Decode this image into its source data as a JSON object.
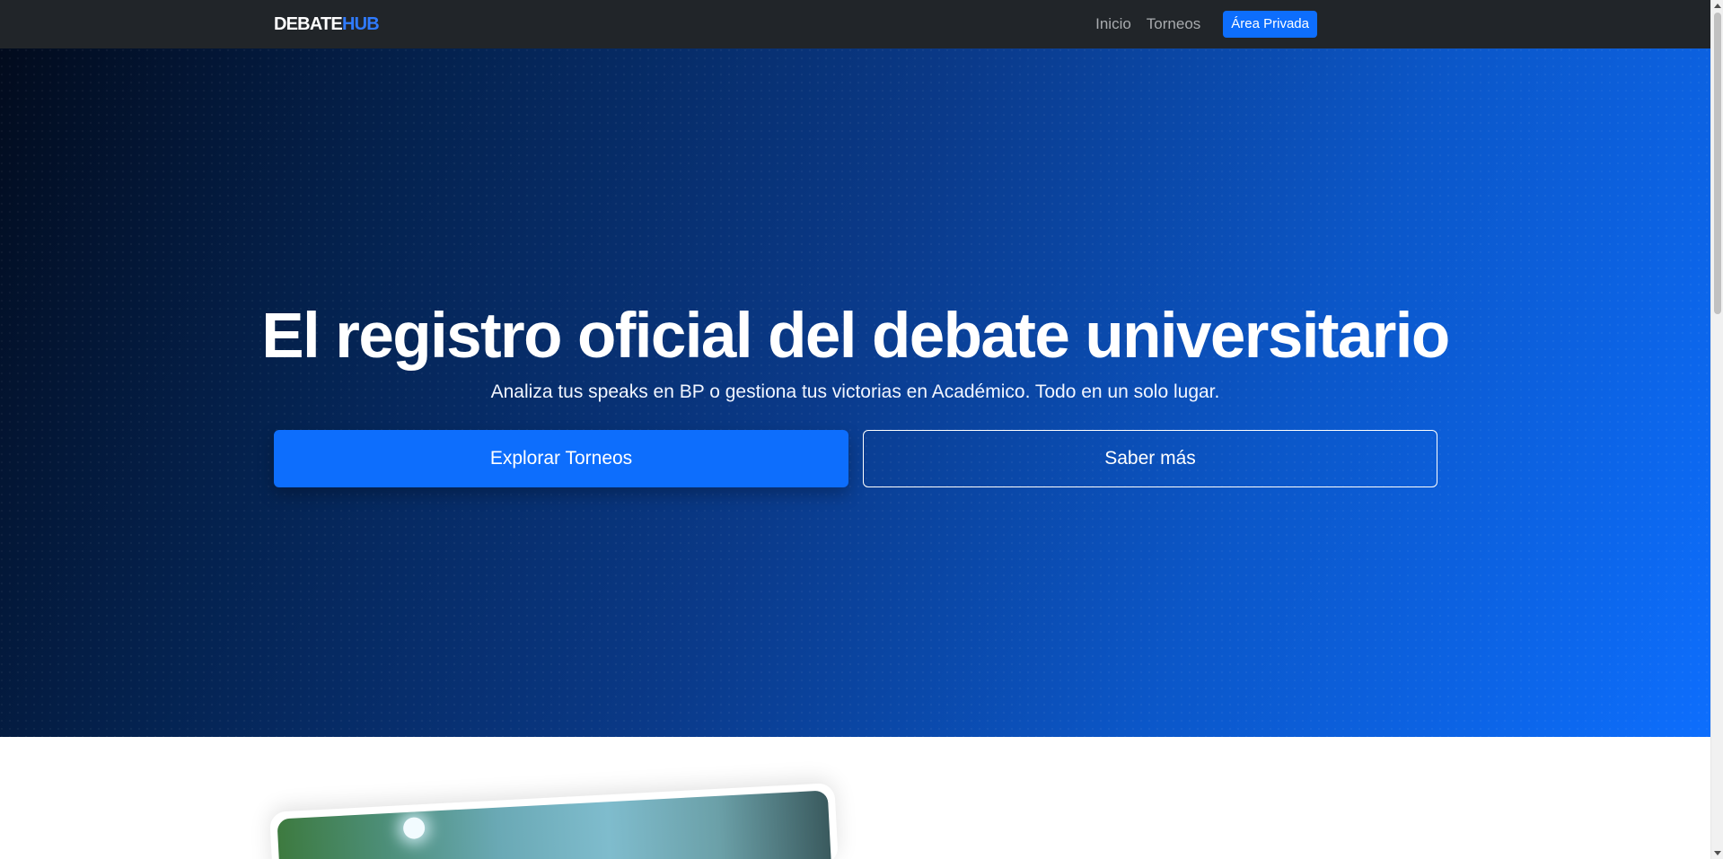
{
  "navbar": {
    "brand_part1": "DEBATE",
    "brand_part2": "HUB",
    "links": [
      "Inicio",
      "Torneos"
    ],
    "private_button": "Área Privada"
  },
  "hero": {
    "title": "El registro oficial del debate universitario",
    "subtitle": "Analiza tus speaks en BP o gestiona tus victorias en Académico. Todo en un solo lugar.",
    "primary_button": "Explorar Torneos",
    "secondary_button": "Saber más"
  },
  "colors": {
    "navbar_bg": "#212529",
    "accent": "#0d6efd",
    "brand_accent": "#2f7bff",
    "hero_dark": "#020b1d",
    "hero_light": "#0d6efd"
  }
}
